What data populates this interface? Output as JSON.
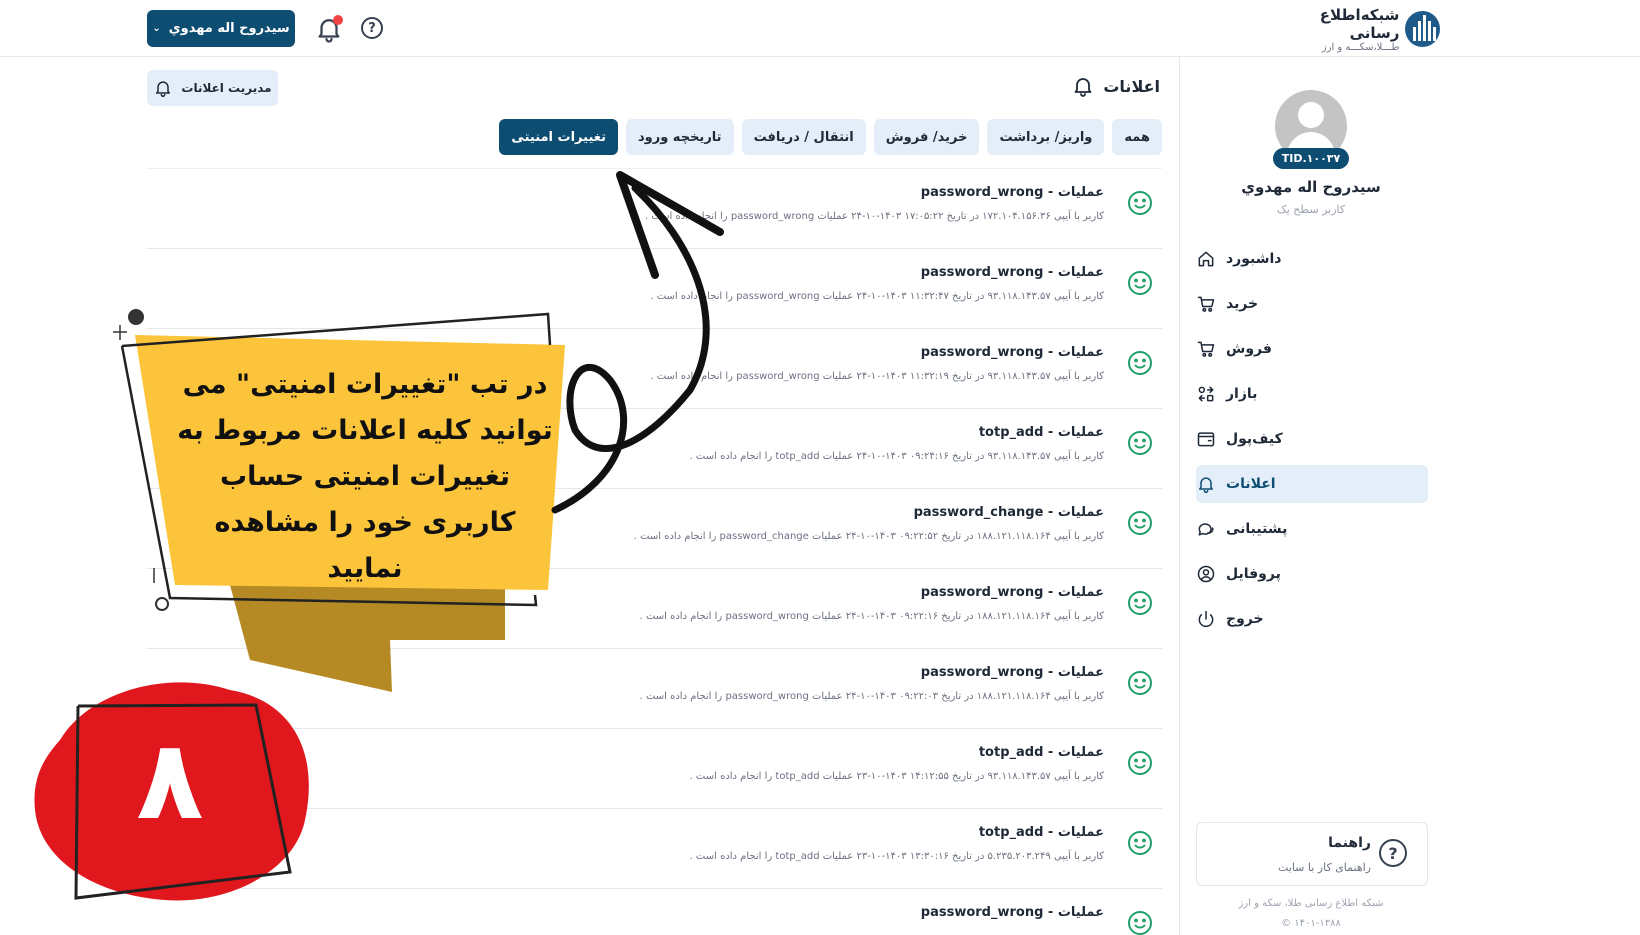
{
  "topbar": {
    "user_button_label": "سيدروح اله مهدوي",
    "chevron_glyph": "⌄",
    "help_glyph": "?",
    "brand_name": "شبکه‌اطلاع رسانی",
    "brand_sub": "طـــلا،سکـــه و ارز"
  },
  "sidebar": {
    "tid": "TID.۱۰۰۳۷",
    "profile_name": "سيدروح اله مهدوي",
    "profile_level": "کاربر سطح یک",
    "items": [
      {
        "label": "داشبورد",
        "icon": "home-icon",
        "active": false
      },
      {
        "label": "خرید",
        "icon": "cart-icon",
        "active": false
      },
      {
        "label": "فروش",
        "icon": "cart-icon",
        "active": false
      },
      {
        "label": "بازار",
        "icon": "exchange-icon",
        "active": false
      },
      {
        "label": "کیف‌پول",
        "icon": "wallet-icon",
        "active": false
      },
      {
        "label": "اعلانات",
        "icon": "bell-icon",
        "active": true
      },
      {
        "label": "پشتیبانی",
        "icon": "chat-icon",
        "active": false
      },
      {
        "label": "پروفایل",
        "icon": "user-circle-icon",
        "active": false
      },
      {
        "label": "خروج",
        "icon": "power-icon",
        "active": false
      }
    ],
    "guide": {
      "title": "راهنما",
      "subtitle": "راهنمای کار با سایت",
      "glyph": "?"
    },
    "footer_line1": "شبکه اطلاع رسانی طلا، سکه و ارز",
    "footer_line2": "© ۱۴۰۱-۱۳۸۸"
  },
  "main": {
    "page_title": "اعلانات",
    "manage_button_label": "مدیریت اعلانات",
    "tabs": [
      {
        "label": "همه",
        "active": false
      },
      {
        "label": "واریز/ برداشت",
        "active": false
      },
      {
        "label": "خرید/ فروش",
        "active": false
      },
      {
        "label": "انتقال / دریافت",
        "active": false
      },
      {
        "label": "تاریخچه ورود",
        "active": false
      },
      {
        "label": "تغییرات امنیتی",
        "active": true
      }
    ],
    "notifications": [
      {
        "title": "عملیات - password_wrong",
        "desc": "کاربر با آیپی ۱۷۲.۱۰۴.۱۵۶.۳۶ در تاریخ ۱۷:۰۵:۲۲ ۱۴۰۳-۱۰-۲۴ عملیات password_wrong را انجام داده است ."
      },
      {
        "title": "عملیات - password_wrong",
        "desc": "کاربر با آیپی ۹۳.۱۱۸.۱۴۳.۵۷ در تاریخ ۱۱:۳۲:۴۷ ۱۴۰۳-۱۰-۲۴ عملیات password_wrong را انجام داده است ."
      },
      {
        "title": "عملیات - password_wrong",
        "desc": "کاربر با آیپی ۹۳.۱۱۸.۱۴۳.۵۷ در تاریخ ۱۱:۳۲:۱۹ ۱۴۰۳-۱۰-۲۴ عملیات password_wrong را انجام داده است ."
      },
      {
        "title": "عملیات - totp_add",
        "desc": "کاربر با آیپی ۹۳.۱۱۸.۱۴۳.۵۷ در تاریخ ۰۹:۲۴:۱۶ ۱۴۰۳-۱۰-۲۴ عملیات totp_add را انجام داده است ."
      },
      {
        "title": "عملیات - password_change",
        "desc": "کاربر با آیپی ۱۸۸.۱۲۱.۱۱۸.۱۶۴ در تاریخ ۰۹:۲۲:۵۲ ۱۴۰۳-۱۰-۲۴ عملیات password_change را انجام داده است ."
      },
      {
        "title": "عملیات - password_wrong",
        "desc": "کاربر با آیپی ۱۸۸.۱۲۱.۱۱۸.۱۶۴ در تاریخ ۰۹:۲۲:۱۶ ۱۴۰۳-۱۰-۲۴ عملیات password_wrong را انجام داده است ."
      },
      {
        "title": "عملیات - password_wrong",
        "desc": "کاربر با آیپی ۱۸۸.۱۲۱.۱۱۸.۱۶۴ در تاریخ ۰۹:۲۲:۰۳ ۱۴۰۳-۱۰-۲۴ عملیات password_wrong را انجام داده است ."
      },
      {
        "title": "عملیات - totp_add",
        "desc": "کاربر با آیپی ۹۳.۱۱۸.۱۴۳.۵۷ در تاریخ ۱۴:۱۲:۵۵ ۱۴۰۳-۱۰-۲۳ عملیات totp_add را انجام داده است ."
      },
      {
        "title": "عملیات - totp_add",
        "desc": "کاربر با آیپی ۵.۲۳۵.۲۰۳.۲۴۹ در تاریخ ۱۳:۳۰:۱۶ ۱۴۰۳-۱۰-۲۳ عملیات totp_add را انجام داده است ."
      },
      {
        "title": "عملیات - password_wrong",
        "desc": ""
      }
    ]
  },
  "overlay": {
    "callout_text": "در تب \"تغییرات امنیتی\" می توانید کلیه اعلانات مربوط به تغییرات امنیتی حساب کاربری خود را مشاهده نمایید",
    "step_number": "۸",
    "colors": {
      "callout": "#fbc43a",
      "callout_shadow": "#b58a24",
      "badge": "#e0181e"
    }
  }
}
